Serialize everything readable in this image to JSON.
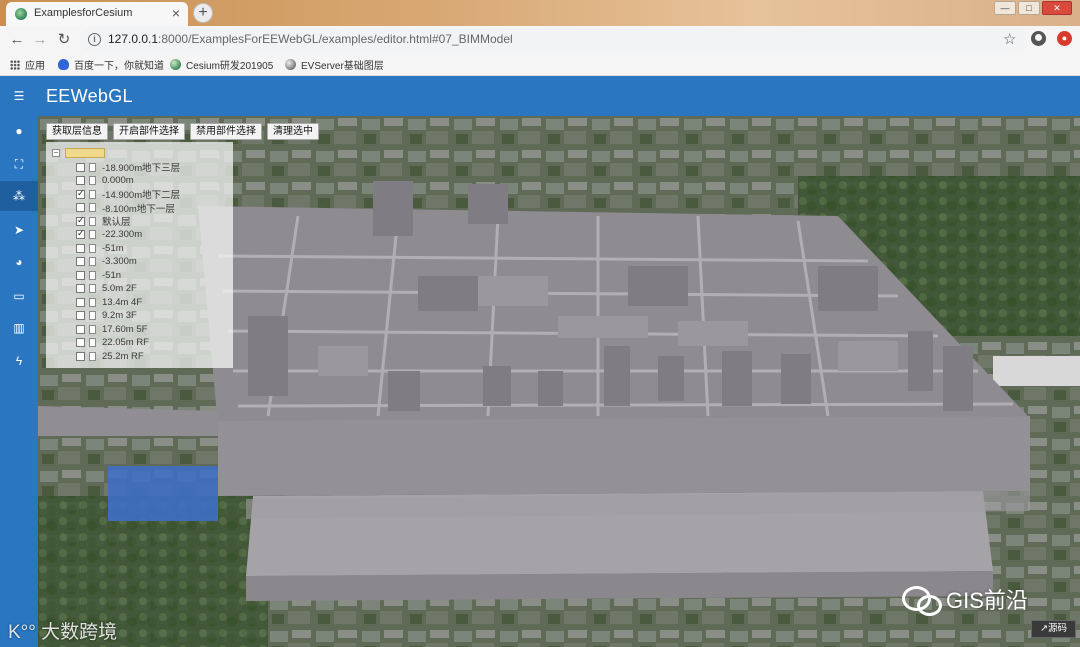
{
  "browser": {
    "tab_title": "ExamplesforCesium",
    "tab_close": "×",
    "new_tab": "+",
    "url_host": "127.0.0.1",
    "url_path": ":8000/ExamplesForEEWebGL/examples/editor.html#07_BIMModel",
    "window_controls": [
      "—",
      "□",
      "✕"
    ],
    "bookmarks": [
      "应用",
      "百度一下，你就知道",
      "Cesium研发201905",
      "EVServer基础图层"
    ]
  },
  "app": {
    "title": "EEWebGL"
  },
  "toolbar": {
    "buttons": [
      "获取层信息",
      "开启部件选择",
      "禁用部件选择",
      "清理选中"
    ]
  },
  "layers": [
    {
      "label": "-18.900m地下三层",
      "checked": false
    },
    {
      "label": "0.000m",
      "checked": false
    },
    {
      "label": "-14.900m地下二层",
      "checked": true
    },
    {
      "label": "-8.100m地下一层",
      "checked": false
    },
    {
      "label": "默认层",
      "checked": true
    },
    {
      "label": "-22.300m",
      "checked": true
    },
    {
      "label": "-51m",
      "checked": false
    },
    {
      "label": "-3.300m",
      "checked": false
    },
    {
      "label": "-51n",
      "checked": false
    },
    {
      "label": "5.0m 2F",
      "checked": false
    },
    {
      "label": "13.4m 4F",
      "checked": false
    },
    {
      "label": "9.2m 3F",
      "checked": false
    },
    {
      "label": "17.60m 5F",
      "checked": false
    },
    {
      "label": "22.05m RF",
      "checked": false
    },
    {
      "label": "25.2m RF",
      "checked": false
    }
  ],
  "watermark": {
    "right": "GIS前沿",
    "left": "K°° 大数跨境",
    "source_button": "↗源码"
  },
  "colors": {
    "accent": "#2b76c0",
    "model": "#8f8c92"
  }
}
